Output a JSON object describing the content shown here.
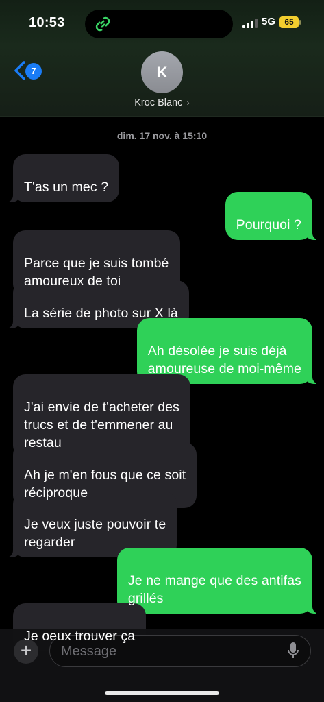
{
  "status_bar": {
    "time": "10:53",
    "network": "5G",
    "battery": "65"
  },
  "header": {
    "back_badge": "7",
    "avatar_initial": "K",
    "contact_name": "Kroc Blanc",
    "contact_chevron": "›"
  },
  "date_label": "dim. 17 nov. à 15:10",
  "messages": [
    {
      "direction": "in",
      "text": "T'as un mec ?"
    },
    {
      "direction": "out",
      "text": "Pourquoi ?"
    },
    {
      "direction": "in",
      "text": "Parce que je suis tombé\namoureux de toi"
    },
    {
      "direction": "in",
      "text": "La série de photo sur X là"
    },
    {
      "direction": "out",
      "text": "Ah désolée je suis déjà\namoureuse de moi-même"
    },
    {
      "direction": "in",
      "text": "J'ai envie de t'acheter des\ntrucs et de t'emmener au\nrestau"
    },
    {
      "direction": "in",
      "text": "Ah je m'en fous que ce soit\nréciproque"
    },
    {
      "direction": "in",
      "text": "Je veux juste pouvoir te\nregarder"
    },
    {
      "direction": "out",
      "text": "Je ne mange que des antifas\ngrillés"
    },
    {
      "direction": "in",
      "text": "Je oeux trouver ça"
    }
  ],
  "composer": {
    "plus_label": "+",
    "placeholder": "Message"
  },
  "colors": {
    "incoming_bubble": "#26252a",
    "outgoing_bubble": "#2fd158",
    "accent": "#1a7cf5"
  },
  "icons": [
    "app-icon",
    "signal-icon",
    "back-chevron-icon",
    "mic-icon"
  ]
}
